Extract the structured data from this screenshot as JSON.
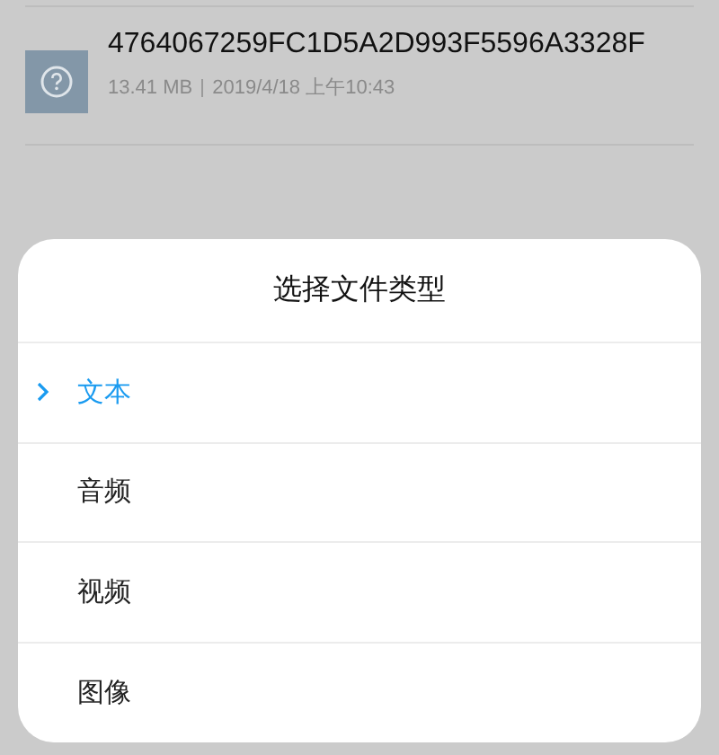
{
  "file": {
    "name": "4764067259FC1D5A2D993F5596A3328F",
    "size": "13.41 MB",
    "modified": "2019/4/18 上午10:43"
  },
  "sheet": {
    "title": "选择文件类型",
    "options": [
      {
        "label": "文本",
        "selected": true
      },
      {
        "label": "音频",
        "selected": false
      },
      {
        "label": "视频",
        "selected": false
      },
      {
        "label": "图像",
        "selected": false
      }
    ]
  }
}
